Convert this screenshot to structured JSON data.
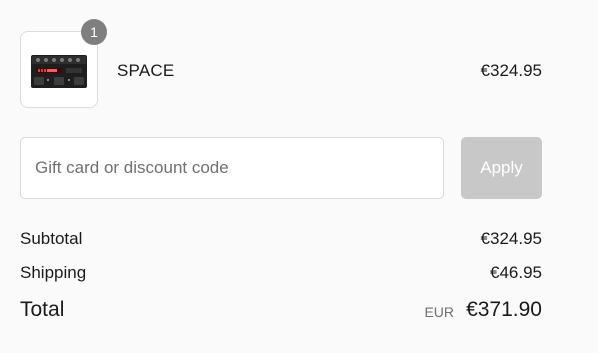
{
  "cart": {
    "item": {
      "quantity": "1",
      "name": "SPACE",
      "price": "€324.95",
      "image_icon": "effects-pedal-thumbnail"
    }
  },
  "discount": {
    "placeholder": "Gift card or discount code",
    "value": "",
    "apply_label": "Apply"
  },
  "summary": {
    "subtotal_label": "Subtotal",
    "subtotal_value": "€324.95",
    "shipping_label": "Shipping",
    "shipping_value": "€46.95",
    "total_label": "Total",
    "total_currency": "EUR",
    "total_value": "€371.90"
  },
  "colors": {
    "background": "#fafafa",
    "badge": "#7f7f7f",
    "apply_disabled": "#c8c8c8",
    "text": "#1a1a1a",
    "muted": "#707070"
  }
}
